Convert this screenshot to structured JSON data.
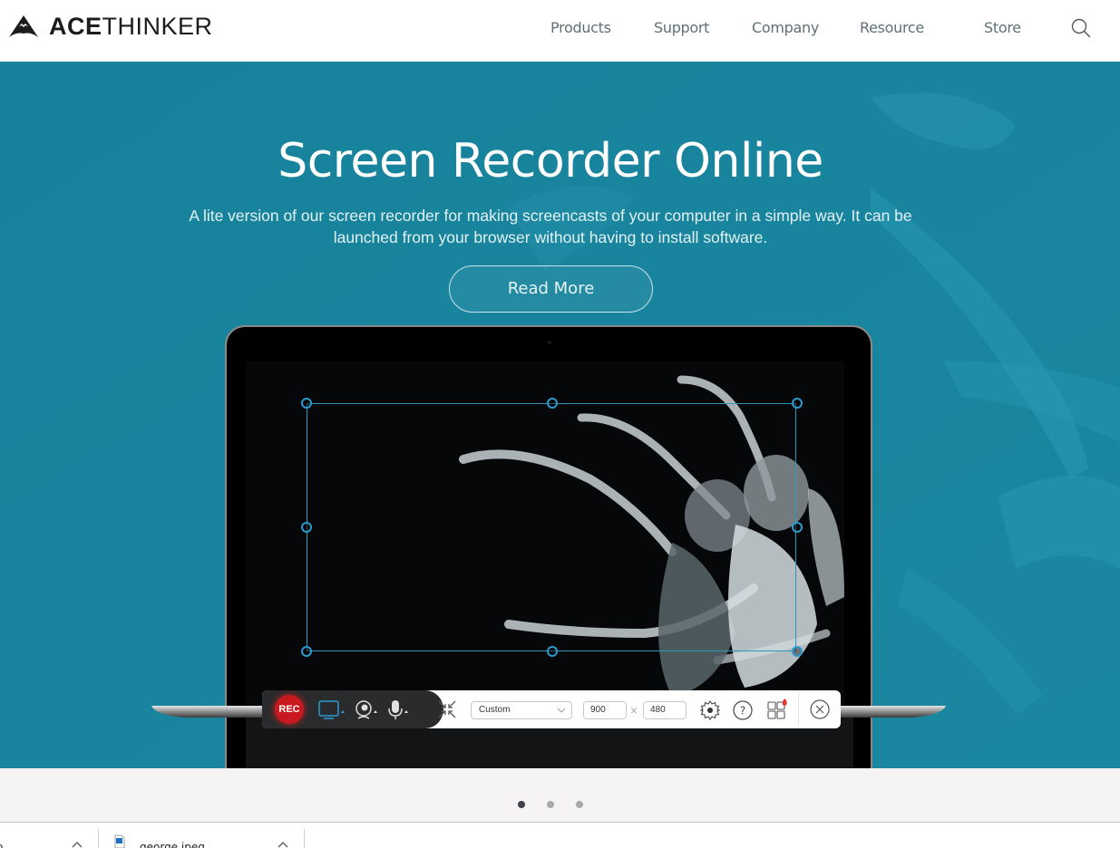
{
  "header": {
    "logo": {
      "bold": "ACE",
      "light": "THINKER"
    },
    "nav": [
      {
        "label": "Products"
      },
      {
        "label": "Support"
      },
      {
        "label": "Company"
      },
      {
        "label": "Resource"
      },
      {
        "label": "Store"
      }
    ],
    "search_icon": "search-icon"
  },
  "hero": {
    "title": "Screen Recorder Online",
    "subtitle": "A lite version of our screen recorder for making screencasts of your computer in a simple way. It can be launched from your browser without having to install software.",
    "cta_label": "Read More",
    "background_color": "#18839c"
  },
  "recorder_toolbar": {
    "rec_label": "REC",
    "icons": [
      "screen-icon",
      "webcam-icon",
      "microphone-icon",
      "fullscreen-shrink-icon",
      "settings-icon",
      "help-icon",
      "apps-icon",
      "close-icon"
    ],
    "region_mode": "Custom",
    "width": "900",
    "height": "480",
    "times_sign": "×",
    "accent": "#2a9bd0",
    "rec_color": "#c8191f"
  },
  "carousel": {
    "total_slides": 3,
    "active_index": 0,
    "active_color": "#3e4349",
    "inactive_color": "#a7acab"
  },
  "download_bar": {
    "items": [
      {
        "name": "o"
      },
      {
        "name": "george.jpeg"
      }
    ]
  }
}
